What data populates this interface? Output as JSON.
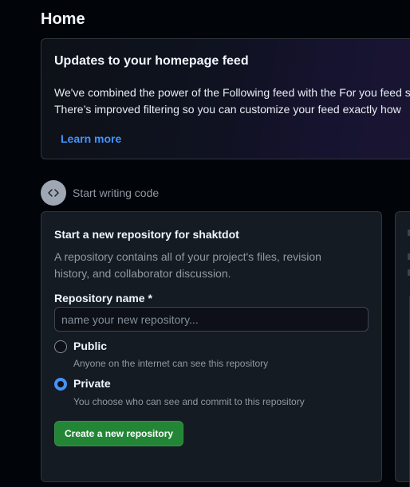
{
  "page": {
    "title": "Home"
  },
  "banner": {
    "title": "Updates to your homepage feed",
    "line1": "We've combined the power of the Following feed with the For you feed so",
    "line2": "There’s improved filtering so you can customize your feed exactly how",
    "link": "Learn more"
  },
  "section": {
    "icon": "code-icon",
    "label": "Start writing code"
  },
  "new_repo": {
    "title": "Start a new repository for shaktdot",
    "description": "A repository contains all of your project's files, revision history, and collaborator discussion.",
    "name_label": "Repository name *",
    "name_placeholder": "name your new repository...",
    "name_value": "",
    "visibility": [
      {
        "label": "Public",
        "hint": "Anyone on the internet can see this repository",
        "checked": false
      },
      {
        "label": "Private",
        "hint": "You choose who can see and commit to this repository",
        "checked": true
      }
    ],
    "create_button": "Create a new repository"
  },
  "colors": {
    "background": "#010409",
    "card": "#151b23",
    "border": "#30363d",
    "link": "#4493f8",
    "primary_button": "#238636"
  }
}
